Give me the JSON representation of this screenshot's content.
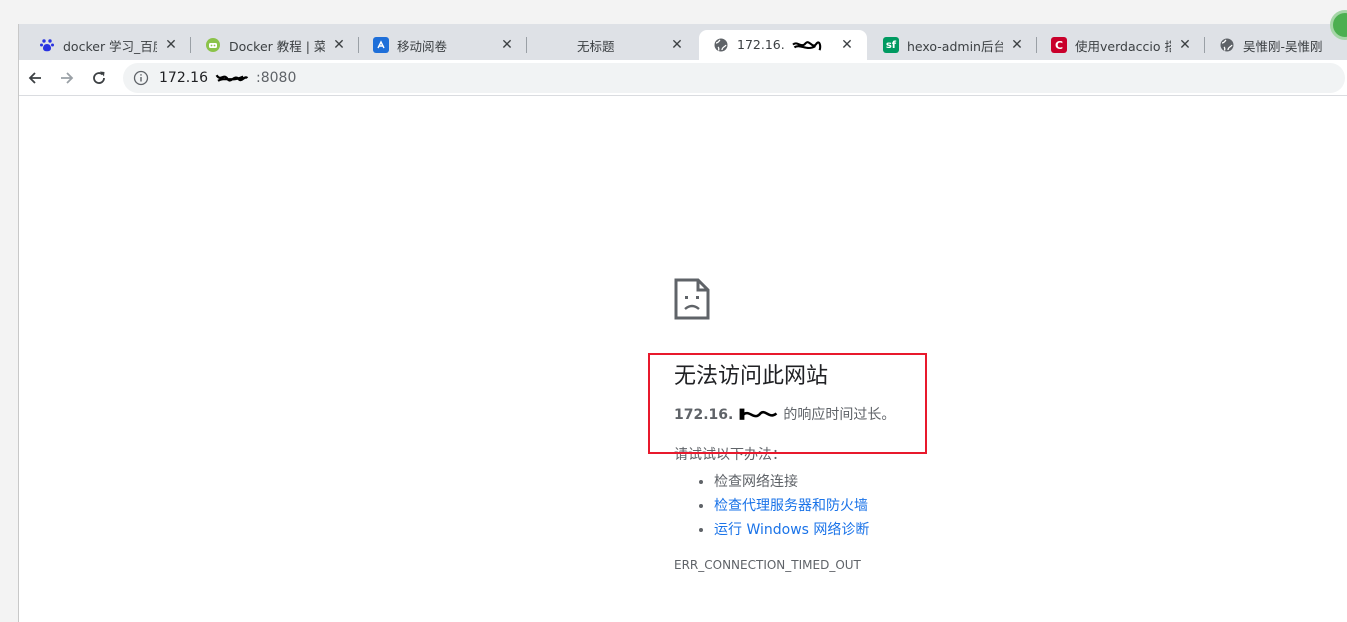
{
  "tabs": [
    {
      "title": "docker 学习_百度搜",
      "favicon": "baidu-icon",
      "color": "#2932e1",
      "active": false
    },
    {
      "title": "Docker 教程 | 菜鸟",
      "favicon": "runoob-icon",
      "color": "#8bc34a",
      "active": false
    },
    {
      "title": "移动阅卷",
      "favicon": "app-icon",
      "color": "#1e6fd9",
      "active": false
    },
    {
      "title": "无标题",
      "favicon": "",
      "color": "",
      "active": false
    },
    {
      "title": "172.16.",
      "favicon": "globe-icon",
      "color": "#5f6368",
      "active": true
    },
    {
      "title": "hexo-admin后台管",
      "favicon": "sf-icon",
      "color": "#009a61",
      "active": false
    },
    {
      "title": "使用verdaccio 搭建",
      "favicon": "c-icon",
      "color": "#c9002b",
      "active": false
    },
    {
      "title": "吴惟刚-吴惟刚",
      "favicon": "globe-icon",
      "color": "#5f6368",
      "active": false
    }
  ],
  "tab_close_glyph": "✕",
  "toolbar": {
    "back_icon": "arrow-left-icon",
    "forward_icon": "arrow-right-icon",
    "reload_icon": "reload-icon",
    "url_prefix": "172.16",
    "url_port": "8080",
    "url_suffix": ":8080"
  },
  "error": {
    "headline": "无法访问此网站",
    "host": "172.16.",
    "detail_suffix": "的响应时间过长。",
    "try_heading": "请试试以下办法：",
    "suggestions": [
      {
        "text": "检查网络连接",
        "link": false
      },
      {
        "text": "检查代理服务器和防火墙",
        "link": true
      },
      {
        "text": "运行 Windows 网络诊断",
        "link": true
      }
    ],
    "code": "ERR_CONNECTION_TIMED_OUT",
    "highlight_color": "#e8192c"
  }
}
